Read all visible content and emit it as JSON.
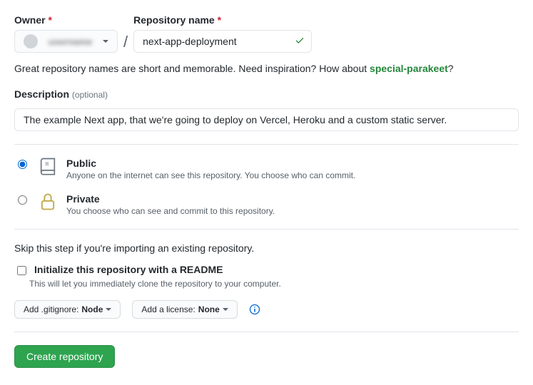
{
  "owner": {
    "label": "Owner",
    "name": "username"
  },
  "repo": {
    "label": "Repository name",
    "value": "next-app-deployment"
  },
  "hint": {
    "prefix": "Great repository names are short and memorable. Need inspiration? How about ",
    "suggestion": "special-parakeet",
    "suffix": "?"
  },
  "description": {
    "label": "Description",
    "optional": "(optional)",
    "value": "The example Next app, that we're going to deploy on Vercel, Heroku and a custom static server."
  },
  "visibility": {
    "public": {
      "title": "Public",
      "sub": "Anyone on the internet can see this repository. You choose who can commit."
    },
    "private": {
      "title": "Private",
      "sub": "You choose who can see and commit to this repository."
    }
  },
  "init": {
    "skip": "Skip this step if you're importing an existing repository.",
    "readme_title": "Initialize this repository with a README",
    "readme_sub": "This will let you immediately clone the repository to your computer."
  },
  "selects": {
    "gitignore_prefix": "Add .gitignore: ",
    "gitignore_value": "Node",
    "license_prefix": "Add a license: ",
    "license_value": "None"
  },
  "submit": "Create repository"
}
